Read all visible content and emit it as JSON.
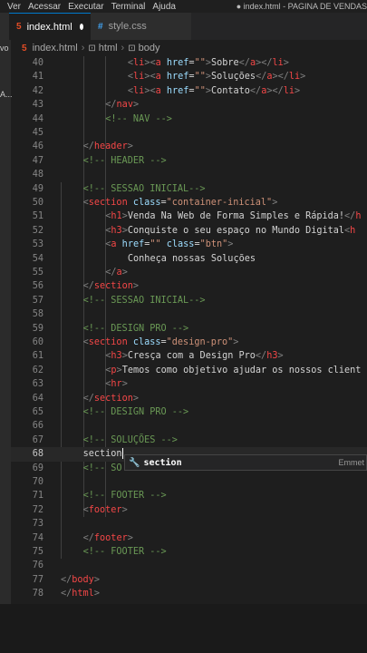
{
  "menu": {
    "items": [
      "Ver",
      "Acessar",
      "Executar",
      "Terminal",
      "Ajuda"
    ],
    "title": "● index.html - PAGINA DE VENDAS"
  },
  "activity": {
    "label_a": "vo",
    "label_b": "A..."
  },
  "tabs": [
    {
      "icon": "5",
      "label": "index.html",
      "modified": true
    },
    {
      "icon": "#",
      "label": "style.css"
    }
  ],
  "breadcrumb": [
    "index.html",
    "html",
    "body"
  ],
  "breadcrumb_icons": {
    "file": "5",
    "tag": "⊡"
  },
  "suggestion": {
    "label": "section",
    "hint": "Emmet"
  },
  "lines": [
    {
      "n": "40",
      "indent": 12,
      "tokens": [
        [
          "br",
          "<"
        ],
        [
          "name",
          "li"
        ],
        [
          "br",
          ">"
        ],
        [
          "br",
          "<"
        ],
        [
          "name",
          "a"
        ],
        [
          "attr",
          " href"
        ],
        [
          "text",
          "="
        ],
        [
          "str",
          "\"\""
        ],
        [
          "br",
          ">"
        ],
        [
          "text",
          "Sobre"
        ],
        [
          "br",
          "</"
        ],
        [
          "name",
          "a"
        ],
        [
          "br",
          "></"
        ],
        [
          "name",
          "li"
        ],
        [
          "br",
          ">"
        ]
      ]
    },
    {
      "n": "41",
      "indent": 12,
      "tokens": [
        [
          "br",
          "<"
        ],
        [
          "name",
          "li"
        ],
        [
          "br",
          ">"
        ],
        [
          "br",
          "<"
        ],
        [
          "name",
          "a"
        ],
        [
          "attr",
          " href"
        ],
        [
          "text",
          "="
        ],
        [
          "str",
          "\"\""
        ],
        [
          "br",
          ">"
        ],
        [
          "text",
          "Soluções"
        ],
        [
          "br",
          "</"
        ],
        [
          "name",
          "a"
        ],
        [
          "br",
          "></"
        ],
        [
          "name",
          "li"
        ],
        [
          "br",
          ">"
        ]
      ]
    },
    {
      "n": "42",
      "indent": 12,
      "tokens": [
        [
          "br",
          "<"
        ],
        [
          "name",
          "li"
        ],
        [
          "br",
          ">"
        ],
        [
          "br",
          "<"
        ],
        [
          "name",
          "a"
        ],
        [
          "attr",
          " href"
        ],
        [
          "text",
          "="
        ],
        [
          "str",
          "\"\""
        ],
        [
          "br",
          ">"
        ],
        [
          "text",
          "Contato"
        ],
        [
          "br",
          "</"
        ],
        [
          "name",
          "a"
        ],
        [
          "br",
          "></"
        ],
        [
          "name",
          "li"
        ],
        [
          "br",
          ">"
        ]
      ]
    },
    {
      "n": "43",
      "indent": 8,
      "tokens": [
        [
          "br",
          "</"
        ],
        [
          "name",
          "nav"
        ],
        [
          "br",
          ">"
        ]
      ]
    },
    {
      "n": "44",
      "indent": 8,
      "tokens": [
        [
          "com",
          "<!-- NAV -->"
        ]
      ]
    },
    {
      "n": "45",
      "indent": 0,
      "tokens": []
    },
    {
      "n": "46",
      "indent": 4,
      "tokens": [
        [
          "br",
          "</"
        ],
        [
          "name",
          "header"
        ],
        [
          "br",
          ">"
        ]
      ]
    },
    {
      "n": "47",
      "indent": 4,
      "tokens": [
        [
          "com",
          "<!-- HEADER -->"
        ]
      ]
    },
    {
      "n": "48",
      "indent": 0,
      "tokens": []
    },
    {
      "n": "49",
      "indent": 4,
      "tokens": [
        [
          "com",
          "<!-- SESSAO INICIAL-->"
        ]
      ]
    },
    {
      "n": "50",
      "indent": 4,
      "tokens": [
        [
          "br",
          "<"
        ],
        [
          "name",
          "section"
        ],
        [
          "attr",
          " class"
        ],
        [
          "text",
          "="
        ],
        [
          "str",
          "\"container-inicial\""
        ],
        [
          "br",
          ">"
        ]
      ]
    },
    {
      "n": "51",
      "indent": 8,
      "tokens": [
        [
          "br",
          "<"
        ],
        [
          "name",
          "h1"
        ],
        [
          "br",
          ">"
        ],
        [
          "text",
          "Venda Na Web de Forma Simples e Rápida!"
        ],
        [
          "br",
          "</"
        ],
        [
          "name",
          "h"
        ]
      ]
    },
    {
      "n": "52",
      "indent": 8,
      "tokens": [
        [
          "br",
          "<"
        ],
        [
          "name",
          "h3"
        ],
        [
          "br",
          ">"
        ],
        [
          "text",
          "Conquiste o seu espaço no Mundo Digital"
        ],
        [
          "br",
          "<"
        ],
        [
          "name",
          "h"
        ]
      ]
    },
    {
      "n": "53",
      "indent": 8,
      "tokens": [
        [
          "br",
          "<"
        ],
        [
          "name",
          "a"
        ],
        [
          "attr",
          " href"
        ],
        [
          "text",
          "="
        ],
        [
          "str",
          "\"\""
        ],
        [
          "attr",
          " class"
        ],
        [
          "text",
          "="
        ],
        [
          "str",
          "\"btn\""
        ],
        [
          "br",
          ">"
        ]
      ]
    },
    {
      "n": "54",
      "indent": 12,
      "tokens": [
        [
          "text",
          "Conheça nossas Soluções"
        ]
      ]
    },
    {
      "n": "55",
      "indent": 8,
      "tokens": [
        [
          "br",
          "</"
        ],
        [
          "name",
          "a"
        ],
        [
          "br",
          ">"
        ]
      ]
    },
    {
      "n": "56",
      "indent": 4,
      "tokens": [
        [
          "br",
          "</"
        ],
        [
          "name",
          "section"
        ],
        [
          "br",
          ">"
        ]
      ]
    },
    {
      "n": "57",
      "indent": 4,
      "tokens": [
        [
          "com",
          "<!-- SESSAO INICIAL-->"
        ]
      ]
    },
    {
      "n": "58",
      "indent": 0,
      "tokens": []
    },
    {
      "n": "59",
      "indent": 4,
      "tokens": [
        [
          "com",
          "<!-- DESIGN PRO -->"
        ]
      ]
    },
    {
      "n": "60",
      "indent": 4,
      "tokens": [
        [
          "br",
          "<"
        ],
        [
          "name",
          "section"
        ],
        [
          "attr",
          " class"
        ],
        [
          "text",
          "="
        ],
        [
          "str",
          "\"design-pro\""
        ],
        [
          "br",
          ">"
        ]
      ]
    },
    {
      "n": "61",
      "indent": 8,
      "tokens": [
        [
          "br",
          "<"
        ],
        [
          "name",
          "h3"
        ],
        [
          "br",
          ">"
        ],
        [
          "text",
          "Cresça com a Design Pro"
        ],
        [
          "br",
          "</"
        ],
        [
          "name",
          "h3"
        ],
        [
          "br",
          ">"
        ]
      ]
    },
    {
      "n": "62",
      "indent": 8,
      "tokens": [
        [
          "br",
          "<"
        ],
        [
          "name",
          "p"
        ],
        [
          "br",
          ">"
        ],
        [
          "text",
          "Temos como objetivo ajudar os nossos client"
        ]
      ]
    },
    {
      "n": "63",
      "indent": 8,
      "tokens": [
        [
          "br",
          "<"
        ],
        [
          "name",
          "hr"
        ],
        [
          "br",
          ">"
        ]
      ]
    },
    {
      "n": "64",
      "indent": 4,
      "tokens": [
        [
          "br",
          "</"
        ],
        [
          "name",
          "section"
        ],
        [
          "br",
          ">"
        ]
      ]
    },
    {
      "n": "65",
      "indent": 4,
      "tokens": [
        [
          "com",
          "<!-- DESIGN PRO -->"
        ]
      ]
    },
    {
      "n": "66",
      "indent": 0,
      "tokens": []
    },
    {
      "n": "67",
      "indent": 4,
      "tokens": [
        [
          "com",
          "<!-- SOLUÇÕES -->"
        ]
      ]
    },
    {
      "n": "68",
      "indent": 4,
      "tokens": [
        [
          "text",
          "section"
        ]
      ],
      "current": true
    },
    {
      "n": "69",
      "indent": 4,
      "tokens": [
        [
          "com",
          "<!-- SO"
        ]
      ]
    },
    {
      "n": "70",
      "indent": 0,
      "tokens": []
    },
    {
      "n": "71",
      "indent": 4,
      "tokens": [
        [
          "com",
          "<!-- FOOTER -->"
        ]
      ]
    },
    {
      "n": "72",
      "indent": 4,
      "tokens": [
        [
          "br",
          "<"
        ],
        [
          "name",
          "footer"
        ],
        [
          "br",
          ">"
        ]
      ]
    },
    {
      "n": "73",
      "indent": 0,
      "tokens": []
    },
    {
      "n": "74",
      "indent": 4,
      "tokens": [
        [
          "br",
          "</"
        ],
        [
          "name",
          "footer"
        ],
        [
          "br",
          ">"
        ]
      ]
    },
    {
      "n": "75",
      "indent": 4,
      "tokens": [
        [
          "com",
          "<!-- FOOTER -->"
        ]
      ]
    },
    {
      "n": "76",
      "indent": 0,
      "tokens": []
    },
    {
      "n": "77",
      "indent": 0,
      "tokens": [
        [
          "br",
          "</"
        ],
        [
          "name",
          "body"
        ],
        [
          "br",
          ">"
        ]
      ]
    },
    {
      "n": "78",
      "indent": 0,
      "tokens": [
        [
          "br",
          "</"
        ],
        [
          "name",
          "html"
        ],
        [
          "br",
          ">"
        ]
      ]
    }
  ]
}
